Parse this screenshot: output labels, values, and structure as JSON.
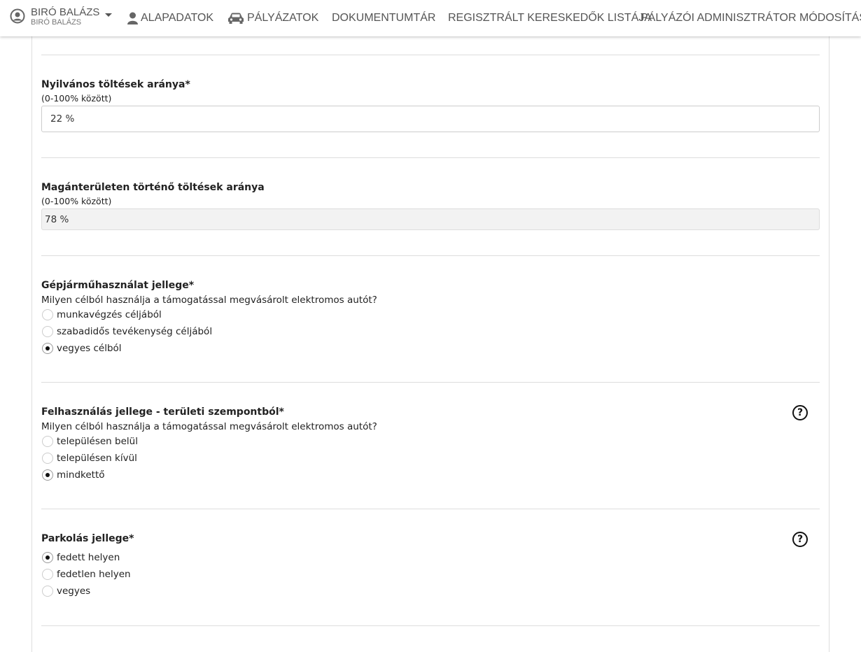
{
  "header": {
    "user": {
      "name": "BIRÓ BALÁZS",
      "subname": "BIRÓ BALÁZS",
      "icon": "user-circle-icon",
      "dropdown_icon": "caret-down-icon"
    },
    "nav": [
      {
        "label": "ALAPADATOK",
        "icon": "user-icon"
      },
      {
        "label": "PÁLYÁZATOK",
        "icon": "car-icon"
      },
      {
        "label": "DOKUMENTUMTÁR"
      },
      {
        "label": "REGISZTRÁLT KERESKEDŐK LISTÁJA"
      },
      {
        "label": "PÁLYÁZÓI ADMINISZTRÁTOR MÓDOSÍTÁSA"
      }
    ]
  },
  "form": {
    "public_charging": {
      "label": "Nyilvános töltések aránya*",
      "hint": "(0-100% között)",
      "value": "22 %"
    },
    "private_charging": {
      "label": "Magánterületen történő töltések aránya",
      "hint": "(0-100% között)",
      "value": "78 %"
    },
    "vehicle_usage": {
      "label": "Gépjárműhasználat jellege*",
      "question": "Milyen célból használja a támogatással megvásárolt elektromos autót?",
      "options": [
        "munkavégzés céljából",
        "szabadidős tevékenység céljából",
        "vegyes célból"
      ],
      "selected": "vegyes célból"
    },
    "area_usage": {
      "label": "Felhasználás jellege - területi szempontból*",
      "question": "Milyen célból használja a támogatással megvásárolt elektromos autót?",
      "options": [
        "településen belül",
        "településen kívül",
        "mindkettő"
      ],
      "selected": "mindkettő",
      "help_icon": "question-circle-icon",
      "help_glyph": "?"
    },
    "parking": {
      "label": "Parkolás jellege*",
      "options": [
        "fedett helyen",
        "fedetlen helyen",
        "vegyes"
      ],
      "selected": "fedett helyen",
      "help_icon": "question-circle-icon",
      "help_glyph": "?"
    }
  }
}
